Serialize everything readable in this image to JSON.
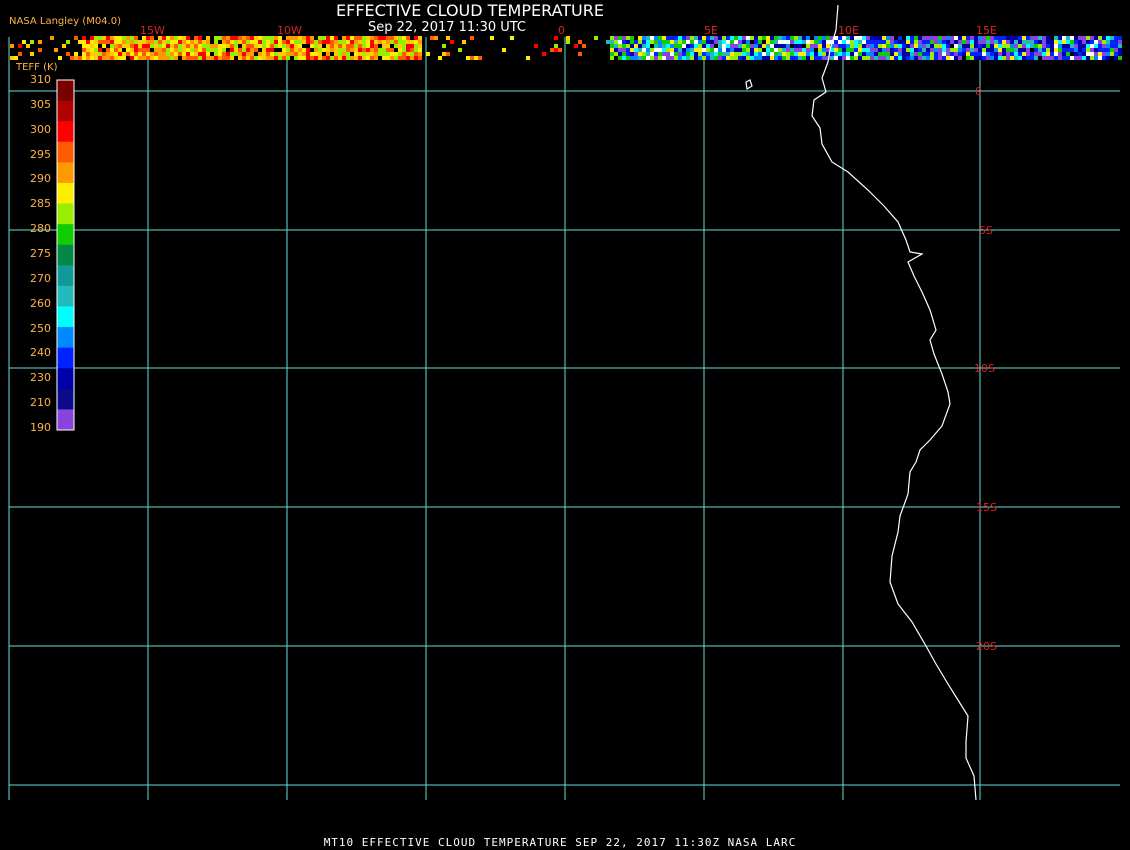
{
  "header": {
    "title": "EFFECTIVE CLOUD TEMPERATURE",
    "subtitle": "Sep 22, 2017 11:30 UTC",
    "credit": "NASA Langley (M04.0)"
  },
  "footer": {
    "text": "MT10  EFFECTIVE CLOUD TEMPERATURE   SEP 22, 2017 11:30Z   NASA LARC"
  },
  "legend": {
    "title": "TEFF (K)",
    "ticks": [
      "310",
      "305",
      "300",
      "295",
      "290",
      "285",
      "280",
      "275",
      "270",
      "260",
      "250",
      "240",
      "230",
      "210",
      "190"
    ],
    "colors": [
      "#7a0000",
      "#b00000",
      "#ff0000",
      "#ff5a00",
      "#ff9900",
      "#ffee00",
      "#99ee00",
      "#11cc00",
      "#008844",
      "#119999",
      "#22bbbb",
      "#00ffff",
      "#0088ff",
      "#0022ff",
      "#0000aa",
      "#0a0a8a",
      "#8844dd"
    ]
  },
  "map": {
    "lon_labels": [
      "15W",
      "10W",
      "0",
      "5E",
      "10E",
      "15E"
    ],
    "lat_labels": [
      "0",
      "5S",
      "10S",
      "15S",
      "20S"
    ],
    "grid_color": "#66dddd",
    "label_color": "#dd2222"
  }
}
